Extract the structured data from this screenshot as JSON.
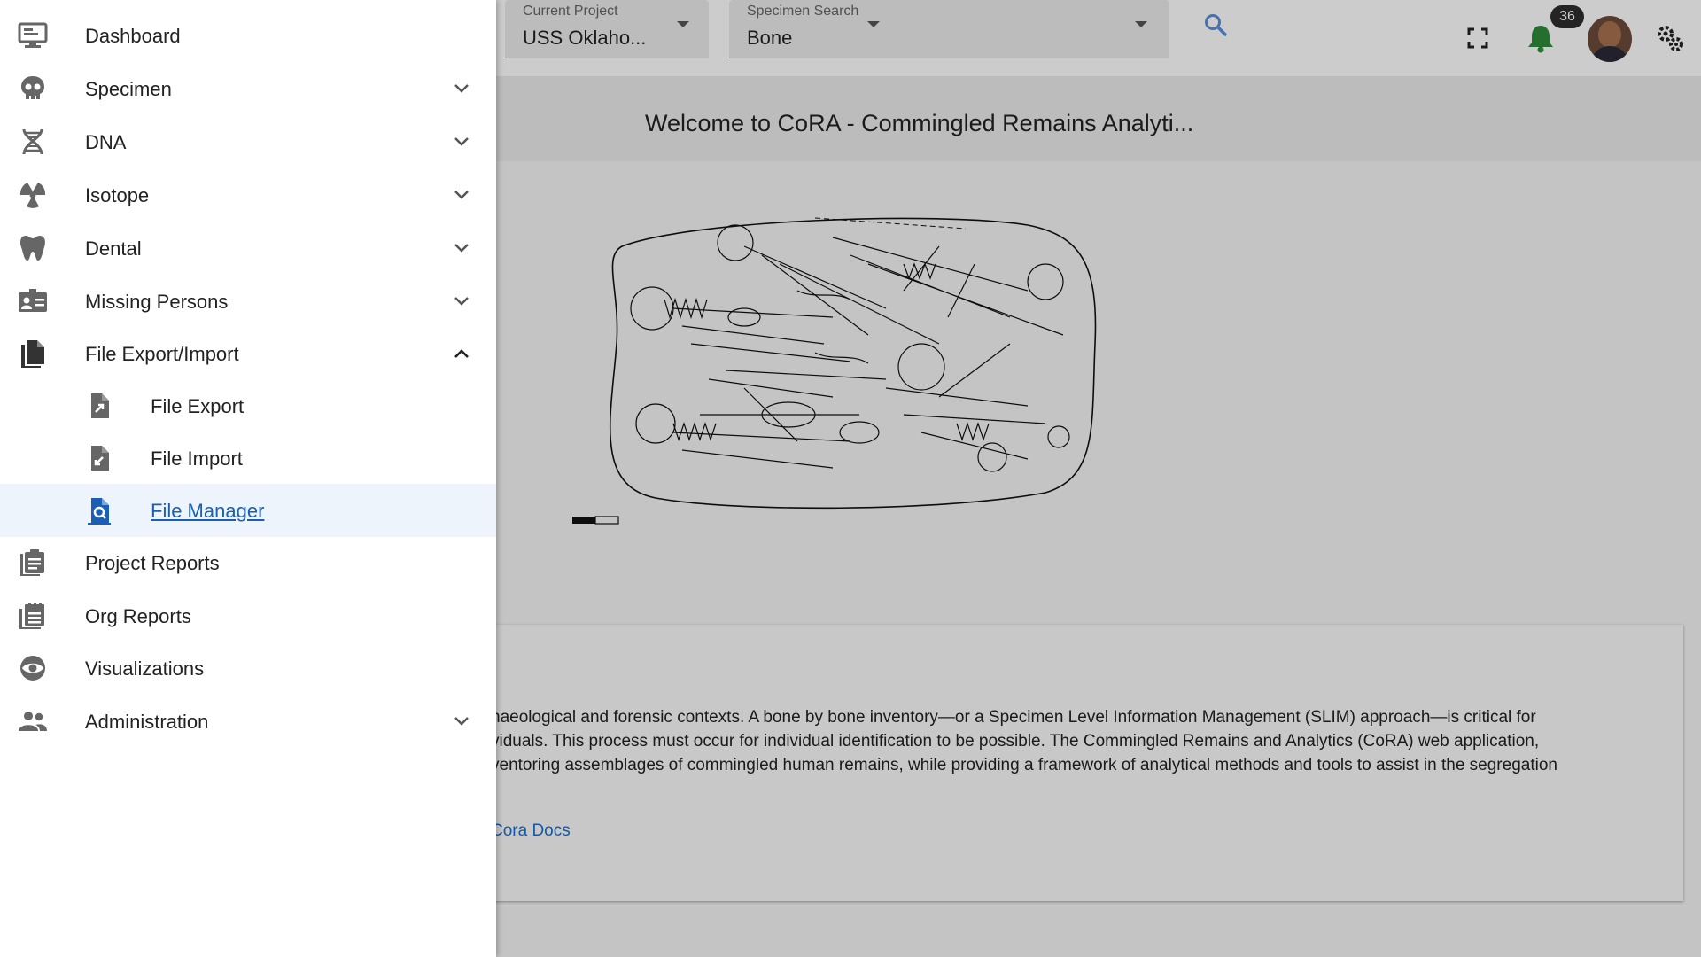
{
  "header": {
    "project_label": "Current Project",
    "project_value": "USS Oklaho...",
    "specimen_label": "Specimen Search",
    "specimen_value": "Bone",
    "notification_count": "36",
    "icons": [
      "search-icon",
      "fullscreen-icon",
      "bell-icon",
      "avatar",
      "settings-icon"
    ]
  },
  "welcome": {
    "title": "Welcome to CoRA - Commingled Remains Analyti..."
  },
  "intro": {
    "line1": "haeological and forensic contexts. A bone by bone inventory—or a Specimen Level Information Management (SLIM) approach—is critical for",
    "line2": "viduals. This process must occur for individual identification to be possible. The Commingled Remains and Analytics (CoRA) web application,",
    "line3": "ventoring assemblages of commingled human remains, while providing a framework of analytical methods and tools to assist in the segregation",
    "docs_link": "Cora Docs"
  },
  "sidebar": {
    "items": [
      {
        "label": "Dashboard",
        "icon": "monitor-icon",
        "expandable": false
      },
      {
        "label": "Specimen",
        "icon": "skull-icon",
        "expandable": true
      },
      {
        "label": "DNA",
        "icon": "dna-icon",
        "expandable": true
      },
      {
        "label": "Isotope",
        "icon": "radiation-icon",
        "expandable": true
      },
      {
        "label": "Dental",
        "icon": "tooth-icon",
        "expandable": true
      },
      {
        "label": "Missing Persons",
        "icon": "id-card-icon",
        "expandable": true
      },
      {
        "label": "File Export/Import",
        "icon": "file-icon",
        "expandable": true,
        "expanded": true
      },
      {
        "label": "File Export",
        "icon": "file-export-icon",
        "sub": true
      },
      {
        "label": "File Import",
        "icon": "file-import-icon",
        "sub": true
      },
      {
        "label": "File Manager",
        "icon": "file-search-icon",
        "sub": true,
        "active": true
      },
      {
        "label": "Project Reports",
        "icon": "clipboard-icon",
        "expandable": false
      },
      {
        "label": "Org Reports",
        "icon": "reports-stack-icon",
        "expandable": false
      },
      {
        "label": "Visualizations",
        "icon": "eye-icon",
        "expandable": false
      },
      {
        "label": "Administration",
        "icon": "people-icon",
        "expandable": true
      }
    ]
  },
  "colors": {
    "accent": "#1a5fb4",
    "bell": "#2e8b3a",
    "link": "#1a6fd1"
  }
}
